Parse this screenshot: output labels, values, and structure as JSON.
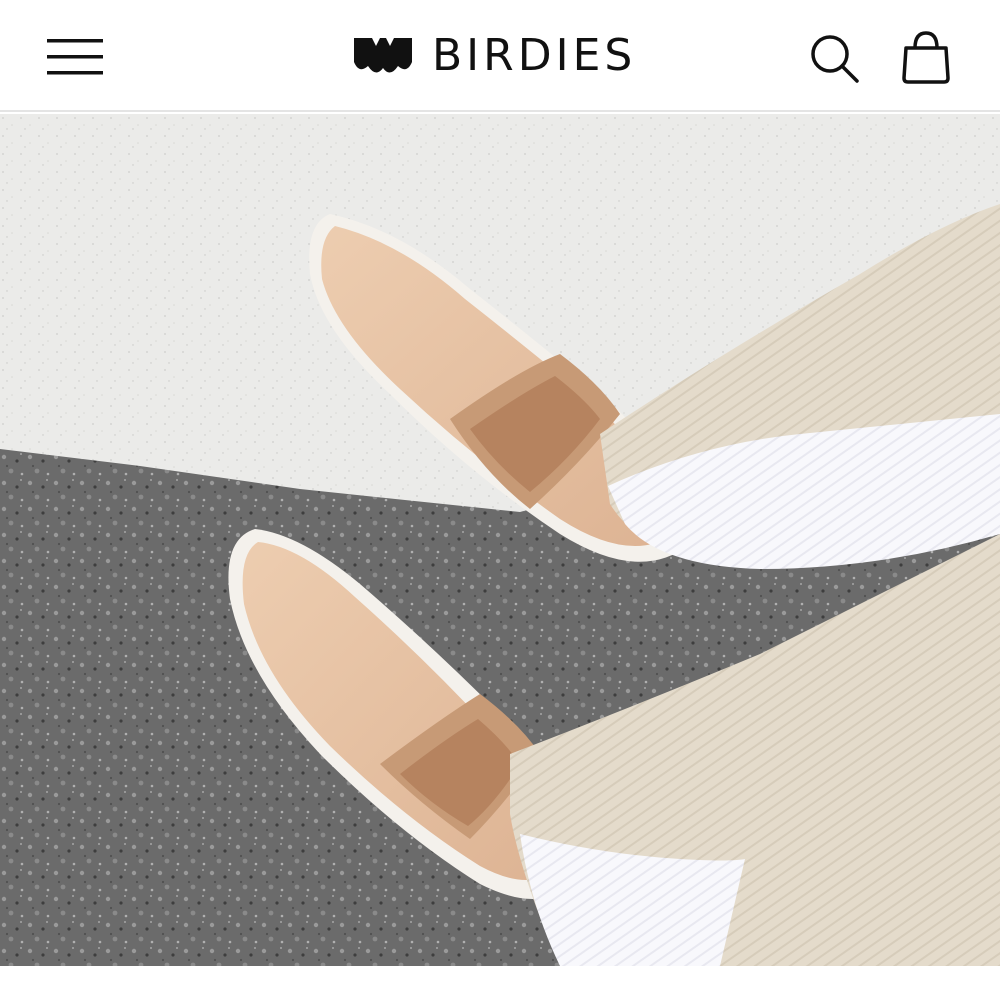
{
  "header": {
    "brand": "BIRDIES",
    "menu_icon": "hamburger-menu-icon",
    "logo_icon": "birdies-logo-icon",
    "search_icon": "search-icon",
    "bag_icon": "shopping-bag-icon"
  },
  "hero": {
    "image_subject": "hero-shoes-image"
  },
  "colors": {
    "text": "#111111",
    "header_border": "#e4e4e4",
    "concrete": "#e9e9e7",
    "asphalt": "#6e6e6e",
    "shoe_suede": "#e6c2a3",
    "pants": "#e5dccc",
    "stripe": "#f7f7fb"
  }
}
